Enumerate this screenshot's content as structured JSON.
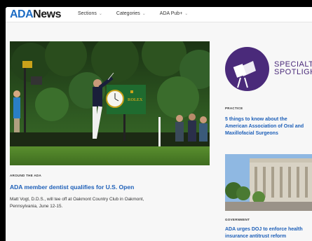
{
  "header": {
    "logo_ada": "ADA",
    "logo_news": "News",
    "nav": [
      {
        "label": "Sections"
      },
      {
        "label": "Categories"
      },
      {
        "label": "ADA Pub+"
      }
    ]
  },
  "main_story": {
    "kicker": "AROUND THE ADA",
    "headline": "ADA member dentist qualifies for U.S. Open",
    "description_line1": "Matt Vogt, D.D.S., will tee off at Oakmont Country Club in Oakmont,",
    "description_line2": "Pennsylvania, June 12-15.",
    "image_sign_text": "ROLEX"
  },
  "specialty_spotlight": {
    "line1": "SPECIALT",
    "line2": "SPOTLIGH"
  },
  "practice_story": {
    "kicker": "PRACTICE",
    "line1": "5 things to know about the",
    "line2": "American Association of Oral and",
    "line3": "Maxillofacial Surgeons"
  },
  "government_story": {
    "kicker": "GOVERNMENT",
    "line1": "ADA urges DOJ to enforce health",
    "line2": "insurance antitrust reform"
  },
  "colors": {
    "brand_blue": "#1d6cc4",
    "headline_blue": "#1d5fb8",
    "spotlight_purple": "#4a2a7a"
  },
  "icons": {
    "chevron": "chevron-down-icon",
    "spotlight": "spotlight-lamp-icon"
  }
}
